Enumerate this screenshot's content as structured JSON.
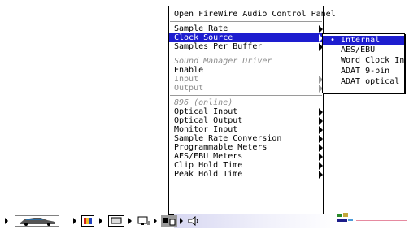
{
  "menu": {
    "items": [
      {
        "label": "Open FireWire Audio Control Panel"
      },
      {
        "label": "Sample Rate"
      },
      {
        "label": "Clock Source"
      },
      {
        "label": "Samples Per Buffer"
      },
      {
        "label": "Sound Manager Driver"
      },
      {
        "label": "Enable"
      },
      {
        "label": "Input"
      },
      {
        "label": "Output"
      },
      {
        "label": "896 (online)"
      },
      {
        "label": "Optical Input"
      },
      {
        "label": "Optical Output"
      },
      {
        "label": "Monitor Input"
      },
      {
        "label": "Sample Rate Conversion"
      },
      {
        "label": "Programmable Meters"
      },
      {
        "label": "AES/EBU Meters"
      },
      {
        "label": "Clip Hold Time"
      },
      {
        "label": "Peak Hold Time"
      }
    ]
  },
  "clock_submenu": {
    "check_mark": "•",
    "items": [
      {
        "label": "Internal",
        "selected": true
      },
      {
        "label": "AES/EBU"
      },
      {
        "label": "Word Clock In"
      },
      {
        "label": "ADAT 9-pin"
      },
      {
        "label": "ADAT optical"
      }
    ]
  },
  "taskbar": {
    "icons": [
      "car-icon",
      "color-display-icon",
      "monitor-icon",
      "network-icon",
      "active-app-icon",
      "speaker-icon"
    ]
  },
  "colors": {
    "highlight": "#1d1dcf"
  }
}
